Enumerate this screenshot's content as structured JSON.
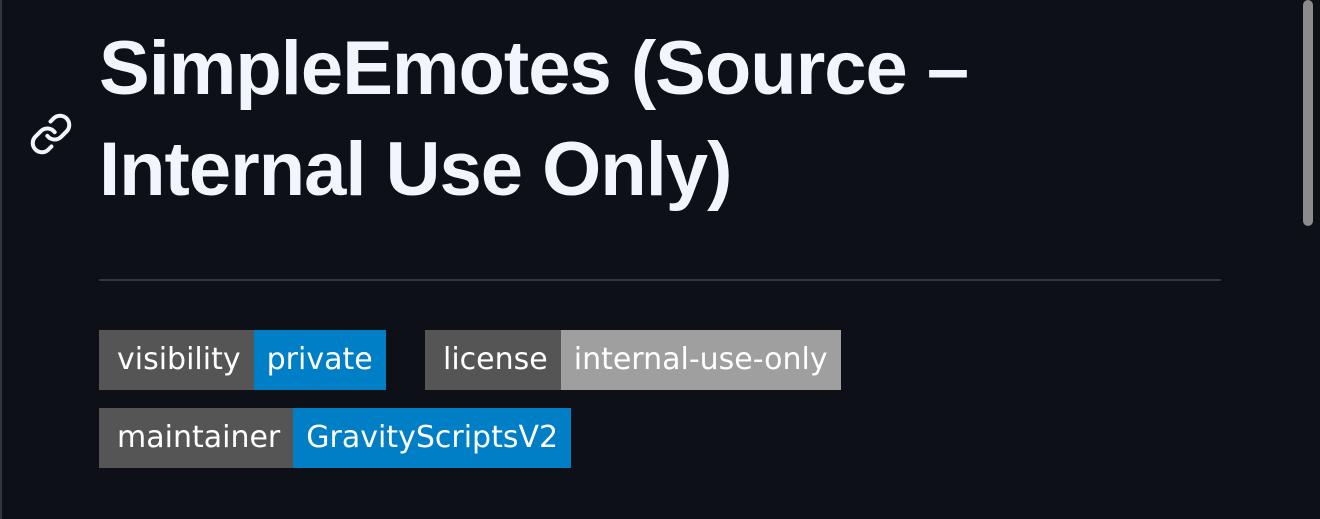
{
  "readme": {
    "title": "SimpleEmotes (Source – Internal Use Only)",
    "anchor_icon": "link-icon",
    "badges": [
      {
        "label": "visibility",
        "value": "private",
        "color": "#007ec6"
      },
      {
        "label": "license",
        "value": "internal-use-only",
        "color": "#9f9f9f"
      },
      {
        "label": "maintainer",
        "value": "GravityScriptsV2",
        "color": "#007ec6"
      }
    ]
  },
  "theme": {
    "background": "#0d1117",
    "text": "#f0f6fc",
    "divider": "#30363d",
    "badge_label_bg": "#555555"
  }
}
